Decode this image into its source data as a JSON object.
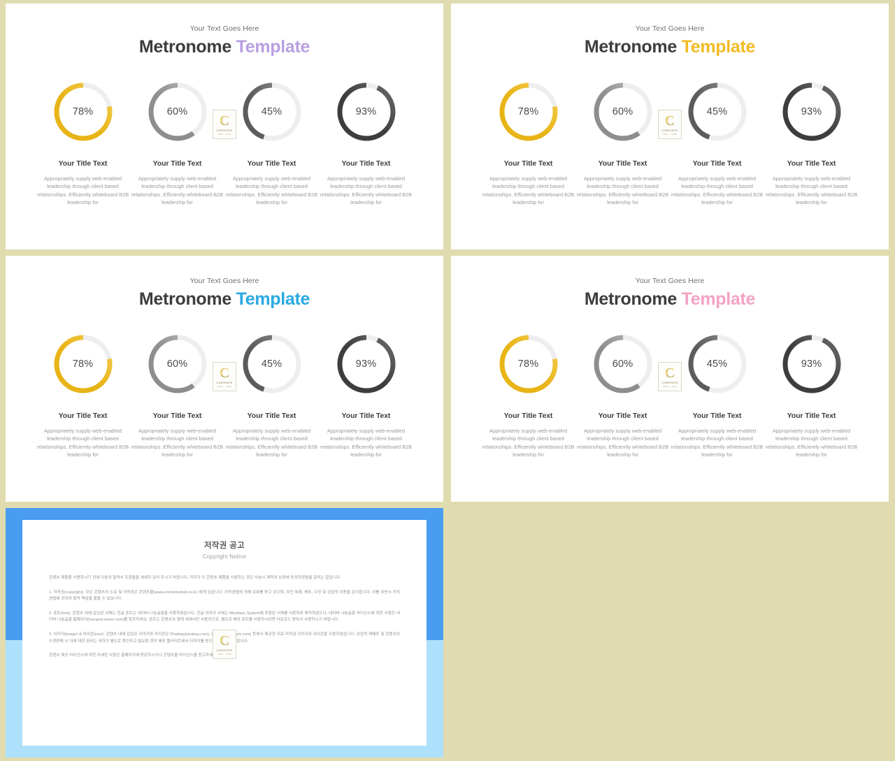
{
  "background_color": "#e0dcb0",
  "slides": [
    {
      "id": "slide-1",
      "eyebrow": "Your Text Goes Here",
      "headline_dark": "Metronome",
      "headline_accent": "Template",
      "accent_color": "#b9a0e0"
    },
    {
      "id": "slide-2",
      "eyebrow": "Your Text Goes Here",
      "headline_dark": "Metronome",
      "headline_accent": "Template",
      "accent_color": "#f2bb26"
    },
    {
      "id": "slide-3",
      "eyebrow": "Your Text Goes Here",
      "headline_dark": "Metronome",
      "headline_accent": "Template",
      "accent_color": "#29a9e1"
    },
    {
      "id": "slide-4",
      "eyebrow": "Your Text Goes Here",
      "headline_dark": "Metronome",
      "headline_accent": "Template",
      "accent_color": "#f4a3c4"
    }
  ],
  "chart_data": {
    "type": "pie",
    "title": "Metronome Template",
    "chart_style": "donut-progress-gauges",
    "legend": "none",
    "grid": false,
    "categories": [
      "Your Title Text",
      "Your Title Text",
      "Your Title Text",
      "Your Title Text"
    ],
    "values": [
      78,
      60,
      45,
      93
    ],
    "value_labels": [
      "78%",
      "60%",
      "45%",
      "93%"
    ],
    "ylim": [
      0,
      100
    ],
    "unit": "%",
    "direction": "counter-clockwise-from-top",
    "track_color": "#eeeeee",
    "series_colors": [
      "#e8b416",
      "#8e8e8e",
      "#5c5c5c",
      "#3d3d3d"
    ],
    "series_colors_light": [
      "#f4cf55",
      "#b9b9b9",
      "#8d8d8d",
      "#6a6a6a"
    ]
  },
  "items": [
    {
      "value": 78,
      "value_label": "78%",
      "title": "Your Title Text",
      "desc": "Appropriately supply web-enabled leadership through client based relationships. Efficiently whiteboard B2B leadership for",
      "color": "#e8b416",
      "color_light": "#f4cf55"
    },
    {
      "value": 60,
      "value_label": "60%",
      "title": "Your Title Text",
      "desc": "Appropriately supply web-enabled leadership through client based relationships. Efficiently whiteboard B2B leadership for",
      "color": "#8e8e8e",
      "color_light": "#bcbcbc"
    },
    {
      "value": 45,
      "value_label": "45%",
      "title": "Your Title Text",
      "desc": "Appropriately supply web-enabled leadership through client based relationships. Efficiently whiteboard B2B leadership for",
      "color": "#5c5c5c",
      "color_light": "#8f8f8f"
    },
    {
      "value": 93,
      "value_label": "93%",
      "title": "Your Title Text",
      "desc": "Appropriately supply web-enabled leadership through client based relationships. Efficiently whiteboard B2B leadership for",
      "color": "#3d3d3d",
      "color_light": "#6b6b6b"
    }
  ],
  "watermark": {
    "monogram": "C",
    "line1": "CONTENTS",
    "line2": "MALL . COM"
  },
  "copyright_slide": {
    "frame_color_top": "#4a9cf0",
    "frame_color_bottom": "#ade1fb",
    "title_ko": "저작권 공고",
    "title_en": "Copyright Notice",
    "paragraphs": [
      "콘텐츠 제품을 사용하시기 전에 다음의 협약서 조항들을 세세히 읽어 주시기 바랍니다. 귀하가 이 콘텐츠 제품을 사용하는 것은 사본시 계약의 보증에 동의하셨음을 알리는 말입니다.",
      "1. 저작권(copyright): 모든 콘텐츠의 소유 및 저작권은 콘텐츠몰(www.contentsmall.co.kr) 에게 있습니다. 저작권법에 의해 보호를 받고 있으며, 무단 복제, 배포, 수정 및 상업적 이용을 금지합니다. 이를 위반시 저작권법에 의하여 법적 책임을 물을 수 있습니다.",
      "2. 폰트(font): 콘텐츠 내에 삽입된 서체는 한글 폰트는 네이버 나눔글꼴을 사용하였습니다. 한글 이외의 서체는 Windows System에 포함된 서체를 사용하여 제작하였으니, 네이버 나눔글꼴 라이선스에 대한 사항은 네이버 나눔글꼴 홈페이지(hangeul.naver.com)를 참조하세요. 폰트는 콘텐츠의 형태 내에서만 사용되므로, 별도로 해당 폰트를 사용하시려면 다운로드 받아서 사용하시기 바랍니다.",
      "3. 이미지(image) & 아이콘(icon): 콘텐츠 내에 삽입된 이미지와 아이콘은 Pixabay(pixabay.com), Weboly(webolyts.com) 등에서 제공한 무료 저작권 이미지와 아이콘을 사용하였습니다. 상업적 재배포 및 콘텐츠의 수정판매 시 이에 대한 권리는 귀하가 별도로 확인하고 필요할 경우 해당 웹사이트에서 이미지를 받으셔야 하시기 바랍니다.",
      "콘텐츠 제공 라이선스에 대한 자세한 사항은 홈페이지에 방문하시거나 콘텐츠몰 라이선스를 참고하세요."
    ]
  }
}
